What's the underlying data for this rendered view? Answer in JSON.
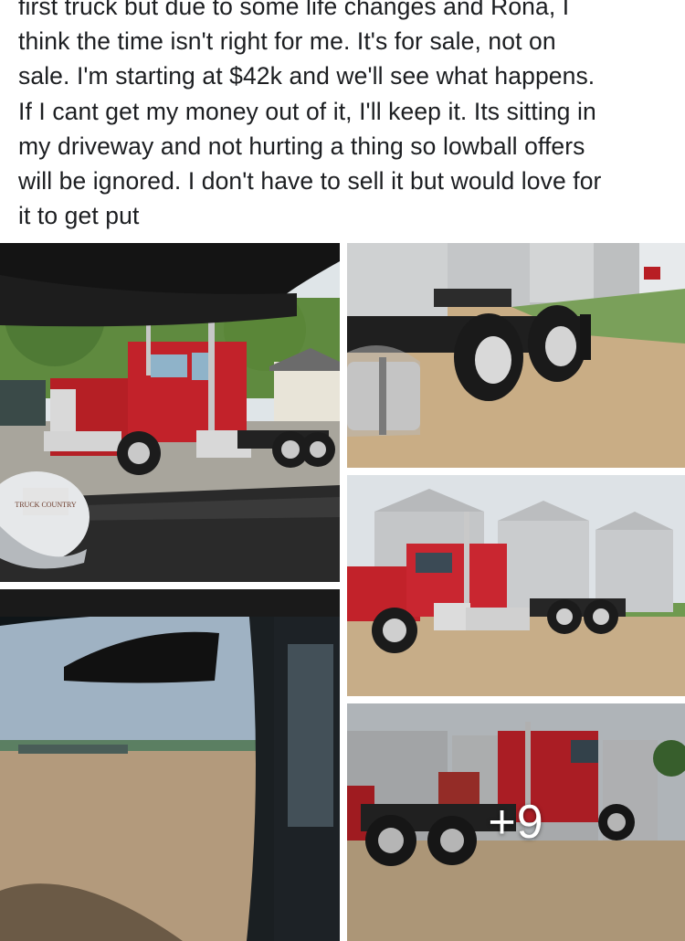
{
  "post": {
    "lines": [
      "first truck but due to some life changes and Rona, I",
      "think the time isn't right for me. It's for sale, not on",
      "sale. I'm starting at $42k and we'll see what happens.",
      "If I cant get my money out of it, I'll keep it. Its sitting in",
      "my driveway and not hurting a thing so lowball offers",
      "will be ignored. I don't have to sell it but would love for",
      "it to get put"
    ]
  },
  "photos": {
    "more_count_label": "+9",
    "cap_logo_text": "TRUCK COUNTRY"
  },
  "colors": {
    "truck_red": "#c8202a",
    "sky": "#cfd6dd",
    "dirt": "#c9ae8a",
    "silo": "#c9ccce"
  }
}
